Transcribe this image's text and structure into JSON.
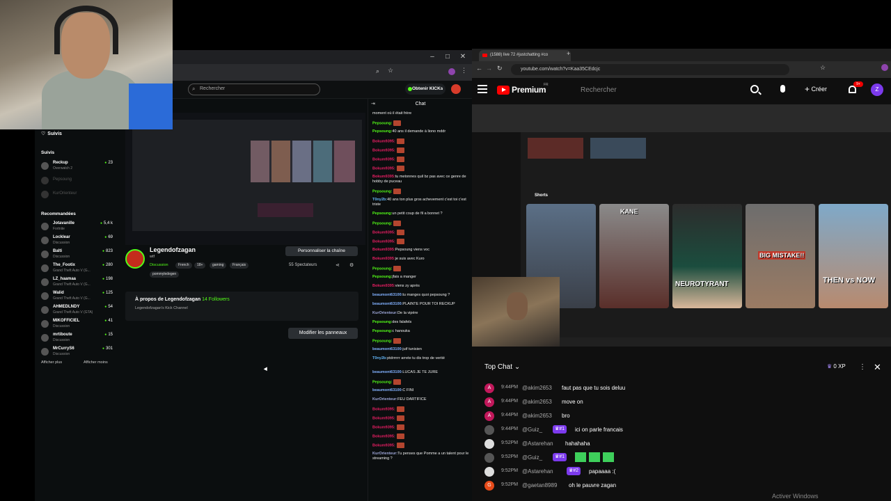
{
  "kick": {
    "search_placeholder": "Rechercher",
    "kicks_button": "Obtenir KICKs",
    "suivis_header": "Suivis",
    "suivis_title": "Suivis",
    "followed": [
      {
        "name": "Reckup",
        "game": "Overwatch 2",
        "viewers": "23"
      },
      {
        "name": "Pepsoung",
        "game": "",
        "viewers": ""
      },
      {
        "name": "KurOrienteur",
        "game": "",
        "viewers": ""
      }
    ],
    "recommended_title": "Recommandées",
    "recommended": [
      {
        "name": "Jotavanille",
        "game": "Fortnite",
        "viewers": "5,4 k"
      },
      {
        "name": "Locklear",
        "game": "Discussion",
        "viewers": "69"
      },
      {
        "name": "Balti",
        "game": "Discussion",
        "viewers": "823"
      },
      {
        "name": "The_Footix",
        "game": "Grand Theft Auto V (G...",
        "viewers": "280"
      },
      {
        "name": "LZ_haamaa",
        "game": "Grand Theft Auto V (G...",
        "viewers": "198"
      },
      {
        "name": "Walid",
        "game": "Grand Theft Auto V (G...",
        "viewers": "125"
      },
      {
        "name": "AHMEDLNDY",
        "game": "Grand Theft Auto V (GTA)",
        "viewers": "54"
      },
      {
        "name": "MIKOFFICIEL",
        "game": "Discussion",
        "viewers": "41"
      },
      {
        "name": "mrtiboute",
        "game": "Discussion",
        "viewers": "15"
      },
      {
        "name": "MrCurryS6",
        "game": "Discussion",
        "viewers": "301"
      }
    ],
    "show_more": "Afficher plus",
    "show_less": "Afficher moins",
    "channel": {
      "name": "Legendofzagan",
      "subtitle": "wtf",
      "category": "Discussion",
      "tags": [
        "French",
        "18+",
        "gaming",
        "Français",
        "pommyledegen"
      ],
      "personalize": "Personnaliser la chaîne",
      "viewers": "55 Spectateurs"
    },
    "about": {
      "title": "À propos de Legendofzagan",
      "followers": "14 Followers",
      "desc": "Legendofzagan's Kick Channel"
    },
    "modify_panels": "Modifier les panneaux",
    "chat_title": "Chat",
    "chat": [
      {
        "u": "",
        "t": "moment où il était frère",
        "c": "#aaa"
      },
      {
        "u": "Pepsoung:",
        "t": "",
        "c": "#53fc18",
        "e": 1
      },
      {
        "u": "Pepsoung:",
        "t": "40 ans il demande à liono mddr",
        "c": "#53fc18"
      },
      {
        "u": "Bokum9395:",
        "t": "",
        "c": "#e91e63",
        "e": 1
      },
      {
        "u": "Bokum9395:",
        "t": "",
        "c": "#e91e63",
        "e": 1
      },
      {
        "u": "Bokum9395:",
        "t": "",
        "c": "#e91e63",
        "e": 1
      },
      {
        "u": "Bokum9395:",
        "t": "",
        "c": "#e91e63",
        "e": 1
      },
      {
        "u": "Bokum9395:",
        "t": "tu metonnes quil bz pas avec ce genre de hobby de puceau",
        "c": "#e91e63"
      },
      {
        "u": "Pepsoung:",
        "t": "",
        "c": "#53fc18",
        "e": 1
      },
      {
        "u": "T0ny2b:",
        "t": "40 ans ton plus gros achevement c'est toi c'est triste",
        "c": "#64b5f6"
      },
      {
        "u": "Pepsoung:",
        "t": "un petit coup de fil a bonnet ?",
        "c": "#53fc18"
      },
      {
        "u": "Pepsoung:",
        "t": "",
        "c": "#53fc18",
        "e": 1
      },
      {
        "u": "Bokum9395:",
        "t": "",
        "c": "#e91e63",
        "e": 1
      },
      {
        "u": "Bokum9395:",
        "t": "",
        "c": "#e91e63",
        "e": 1
      },
      {
        "u": "Bokum9395:",
        "t": "Pepsoung viens voc",
        "c": "#e91e63"
      },
      {
        "u": "Bokum9395:",
        "t": "je suis avec Kuro",
        "c": "#e91e63"
      },
      {
        "u": "Pepsoung:",
        "t": "",
        "c": "#53fc18",
        "e": 1
      },
      {
        "u": "Pepsoung:",
        "t": "jfais a manger",
        "c": "#53fc18"
      },
      {
        "u": "Bokum9395:",
        "t": "viens zy après",
        "c": "#e91e63"
      },
      {
        "u": "beaumont63100:",
        "t": "tu manges quoi pepsoung ?",
        "c": "#82b1ff"
      },
      {
        "u": "beaumont63100:",
        "t": "PLAINTE POUR TOI RECKUP",
        "c": "#82b1ff"
      },
      {
        "u": "KurOrienteur:",
        "t": "De la vipère",
        "c": "#9fa8da"
      },
      {
        "u": "Pepsoung:",
        "t": "des falafels",
        "c": "#53fc18"
      },
      {
        "u": "Pepsoung:",
        "t": "c hanouka",
        "c": "#53fc18"
      },
      {
        "u": "Pepsoung:",
        "t": "",
        "c": "#53fc18",
        "e": 1
      },
      {
        "u": "beaumont63100:",
        "t": "juif tunisien",
        "c": "#82b1ff"
      },
      {
        "u": "T0ny2b:",
        "t": "ptdrrrrrr arrete tu dis trop de verité",
        "c": "#64b5f6"
      },
      {
        "u": "beaumont63100:",
        "t": "LUCAS JE TE JURE",
        "c": "#82b1ff"
      },
      {
        "u": "Pepsoung:",
        "t": "",
        "c": "#53fc18",
        "e": 1
      },
      {
        "u": "beaumont63100:",
        "t": "C FINI",
        "c": "#82b1ff"
      },
      {
        "u": "KurOrienteur:",
        "t": "FEU DARTIFICE",
        "c": "#9fa8da"
      },
      {
        "u": "Bokum9395:",
        "t": "",
        "c": "#e91e63",
        "e": 1
      },
      {
        "u": "Bokum9395:",
        "t": "",
        "c": "#e91e63",
        "e": 1
      },
      {
        "u": "Bokum9395:",
        "t": "",
        "c": "#e91e63",
        "e": 1
      },
      {
        "u": "Bokum9395:",
        "t": "",
        "c": "#e91e63",
        "e": 1
      },
      {
        "u": "Bokum9395:",
        "t": "",
        "c": "#e91e63",
        "e": 1
      },
      {
        "u": "KurOrienteur:",
        "t": "Tu penses que Pomme a un talent pour le streaming ?",
        "c": "#9fa8da"
      }
    ]
  },
  "youtube": {
    "tab_title": "(1588) live 72 #justchatting #co",
    "url": "youtube.com/watch?v=Kaa35CEdcjc",
    "logo_text": "Premium",
    "logo_region": "FR",
    "search_placeholder": "Rechercher",
    "create_label": "Créer",
    "notif_badge": "9+",
    "avatar_letter": "Z",
    "shorts_label": "Shorts",
    "short_captions": [
      "",
      "KANE",
      "NEUROTYRANT",
      "BIG MISTAKE!!",
      "THEN vs NOW"
    ],
    "top_chat": "Top Chat",
    "xp": "0 XP",
    "chat": [
      {
        "av": "A",
        "avc": "#c2185b",
        "time": "9:44PM",
        "author": "@akim2653",
        "badge": "",
        "text": "faut pas que tu sois deluu"
      },
      {
        "av": "A",
        "avc": "#c2185b",
        "time": "9:44PM",
        "author": "@akim2653",
        "badge": "",
        "text": "move on"
      },
      {
        "av": "A",
        "avc": "#c2185b",
        "time": "9:44PM",
        "author": "@akim2653",
        "badge": "",
        "text": "bro"
      },
      {
        "av": "",
        "avc": "#555",
        "time": "9:44PM",
        "author": "@Guiz_",
        "badge": "#1",
        "text": "ici on parle francais"
      },
      {
        "av": "",
        "avc": "#ddd",
        "time": "9:52PM",
        "author": "@Astarehan",
        "badge": "",
        "text": "hahahaha"
      },
      {
        "av": "",
        "avc": "#555",
        "time": "9:52PM",
        "author": "@Guiz_",
        "badge": "#1",
        "text": ""
      },
      {
        "av": "",
        "avc": "#ddd",
        "time": "9:52PM",
        "author": "@Astarehan",
        "badge": "#2",
        "text": "papaaaa :("
      },
      {
        "av": "G",
        "avc": "#e64a19",
        "time": "9:52PM",
        "author": "@gaetan8989",
        "badge": "",
        "text": "oh le pauvre zagan"
      }
    ]
  },
  "os": {
    "activate_windows": "Activer Windows"
  }
}
